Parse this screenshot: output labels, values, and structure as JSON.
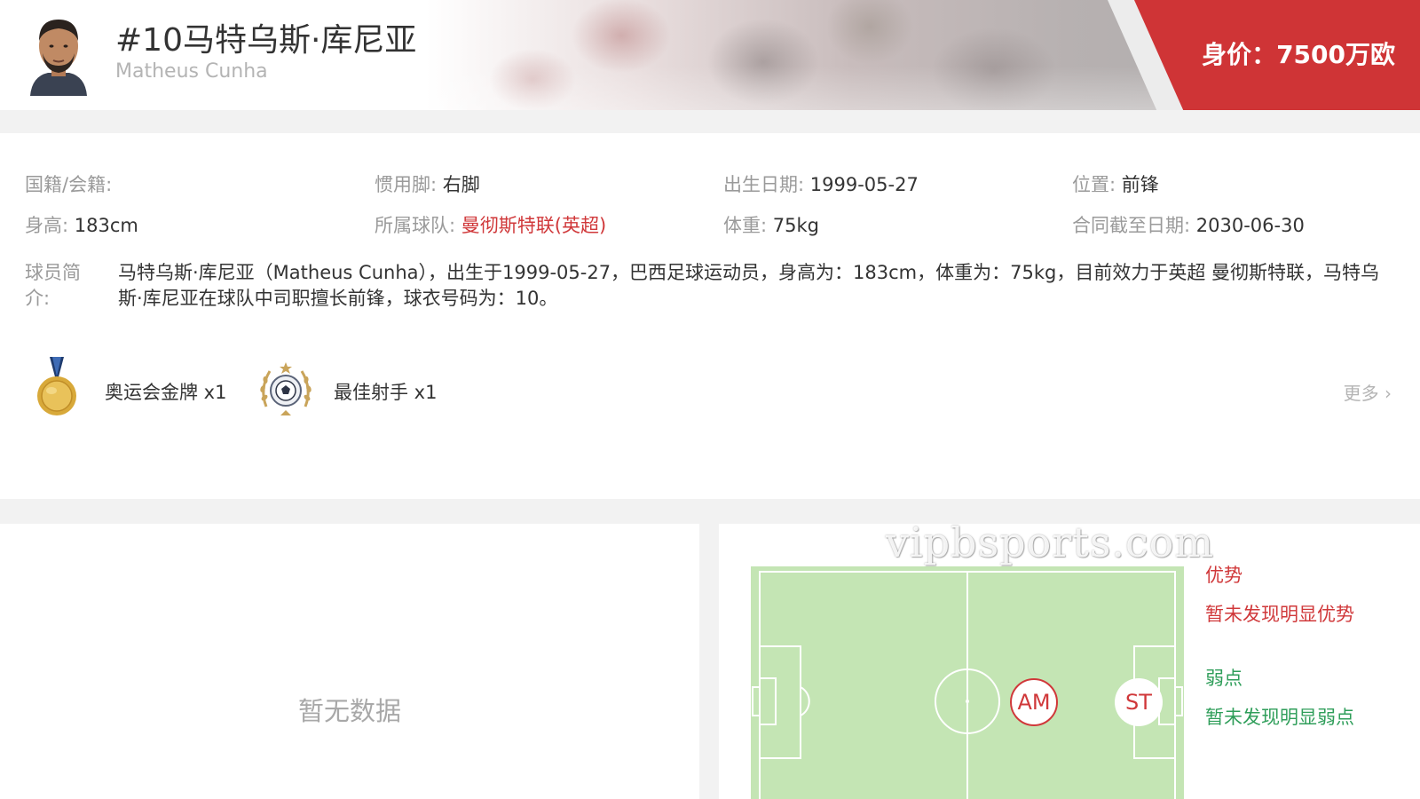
{
  "header": {
    "player_title": "#10马特乌斯·库尼亚",
    "player_en_name": "Matheus Cunha",
    "market_value": "身价：7500万欧",
    "avatar_icon": "player-avatar-icon",
    "accent_color": "#cf3436"
  },
  "info": {
    "nationality_label": "国籍/会籍:",
    "foot_label": "惯用脚:",
    "foot_value": "右脚",
    "birth_label": "出生日期:",
    "birth_value": "1999-05-27",
    "position_label": "位置:",
    "position_value": "前锋",
    "height_label": "身高:",
    "height_value": "183cm",
    "team_label": "所属球队:",
    "team_value": "曼彻斯特联(英超)",
    "weight_label": "体重:",
    "weight_value": "75kg",
    "contract_label": "合同截至日期:",
    "contract_value": "2030-06-30",
    "bio_label": "球员简介:",
    "bio_text": "马特乌斯·库尼亚（Matheus Cunha），出生于1999-05-27，巴西足球运动员，身高为：183cm，体重为：75kg，目前效力于英超 曼彻斯特联，马特乌斯·库尼亚在球队中司职擅长前锋，球衣号码为：10。"
  },
  "honors": [
    {
      "label": "奥运会金牌 x1",
      "icon": "gold-medal-icon"
    },
    {
      "label": "最佳射手 x1",
      "icon": "top-scorer-icon"
    }
  ],
  "more_label": "更多",
  "left_panel": {
    "empty_text": "暂无数据"
  },
  "right_panel": {
    "watermark": "vipbsports.com",
    "positions": [
      "AM",
      "ST"
    ],
    "strengths_title": "优势",
    "strengths_text": "暂未发现明显优势",
    "weaknesses_title": "弱点",
    "weaknesses_text": "暂未发现明显弱点",
    "pitch_color": "#c4e5b4"
  }
}
